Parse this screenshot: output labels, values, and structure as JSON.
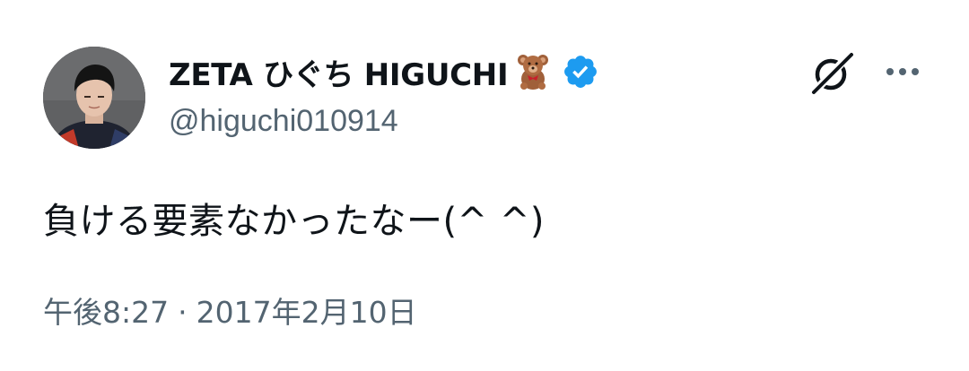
{
  "author": {
    "display_name": "ZETA ひぐち HIGUCHI",
    "handle": "@higuchi010914",
    "name_emoji": "teddy-bear-emoji",
    "verified_badge": "verified-badge-icon"
  },
  "header_actions": {
    "grok_icon": "grok-icon",
    "more_icon": "more-options-icon"
  },
  "tweet": {
    "text": "負ける要素なかったなー(^ ^)",
    "time": "午後8:27",
    "separator": "·",
    "date": "2017年2月10日"
  },
  "colors": {
    "primary_text": "#0f1419",
    "secondary_text": "#536471",
    "verified_blue": "#1d9bf0",
    "background": "#ffffff"
  }
}
